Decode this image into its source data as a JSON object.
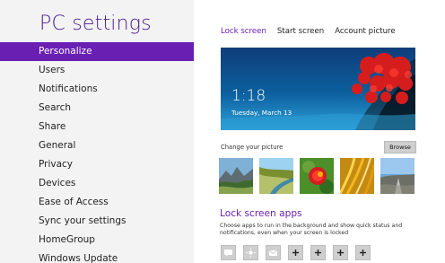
{
  "left": {
    "title": "PC settings",
    "nav": [
      {
        "label": "Personalize",
        "active": true
      },
      {
        "label": "Users"
      },
      {
        "label": "Notifications"
      },
      {
        "label": "Search"
      },
      {
        "label": "Share"
      },
      {
        "label": "General"
      },
      {
        "label": "Privacy"
      },
      {
        "label": "Devices"
      },
      {
        "label": "Ease of Access"
      },
      {
        "label": "Sync your settings"
      },
      {
        "label": "HomeGroup"
      },
      {
        "label": "Windows Update"
      }
    ]
  },
  "right": {
    "tabs": [
      {
        "label": "Lock screen",
        "active": true
      },
      {
        "label": "Start screen"
      },
      {
        "label": "Account picture"
      }
    ],
    "preview": {
      "time": "1:18",
      "date": "Tuesday, March 13"
    },
    "change_label": "Change your picture",
    "browse_label": "Browse",
    "thumbnails": [
      "mountain-valley-thumb",
      "river-canyon-thumb",
      "red-flower-thumb",
      "golden-grass-thumb",
      "road-sky-thumb"
    ],
    "apps_title": "Lock screen apps",
    "apps_desc": "Choose apps to run in the background and show quick status and notifications, even when your screen is locked",
    "app_slots": [
      {
        "icon": "message-icon"
      },
      {
        "icon": "sun-icon"
      },
      {
        "icon": "mail-icon"
      },
      {
        "icon": "plus-icon"
      },
      {
        "icon": "plus-icon"
      },
      {
        "icon": "plus-icon"
      },
      {
        "icon": "plus-icon"
      }
    ]
  },
  "colors": {
    "accent": "#6a1fb3",
    "title": "#4a1d8c",
    "left_bg": "#f3f3f3"
  }
}
